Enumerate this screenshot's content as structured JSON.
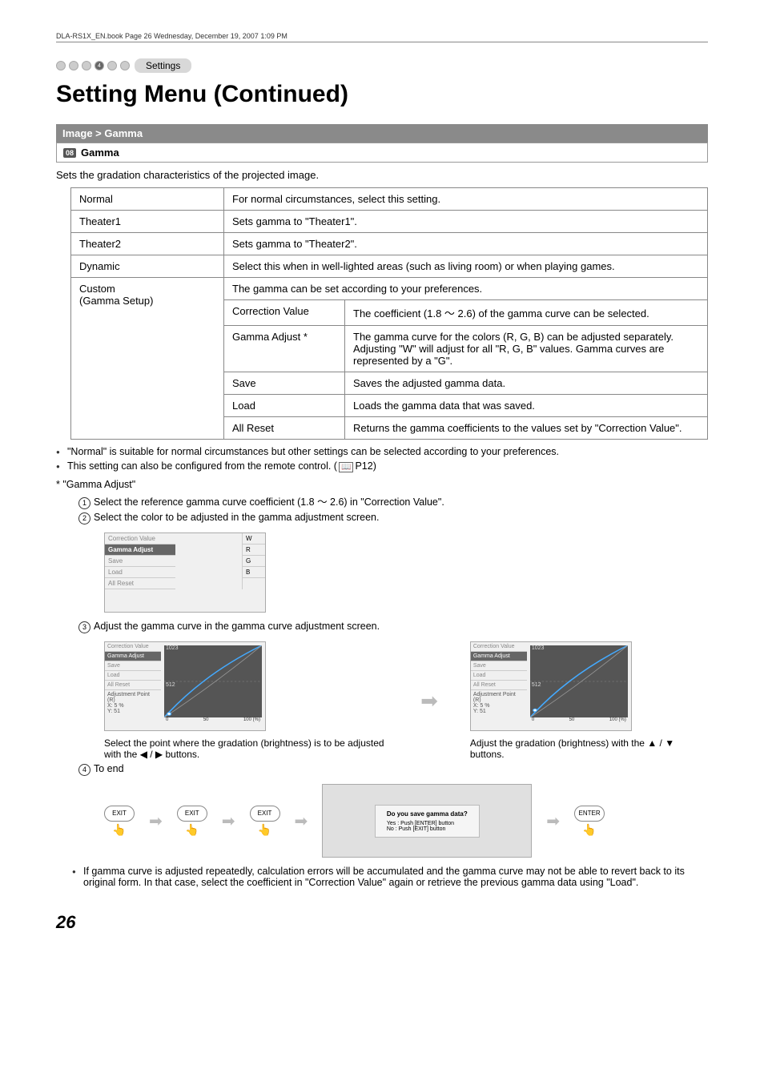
{
  "header": {
    "book_info": "DLA-RS1X_EN.book  Page 26  Wednesday, December 19, 2007  1:09 PM"
  },
  "tab": {
    "number": "4",
    "label": "Settings"
  },
  "title": "Setting Menu (Continued)",
  "breadcrumb": "Image > Gamma",
  "section": {
    "badge": "08",
    "name": "Gamma"
  },
  "intro": "Sets the gradation characteristics of the projected image.",
  "rows": {
    "normal": {
      "name": "Normal",
      "desc": "For normal circumstances, select this setting."
    },
    "theater1": {
      "name": "Theater1",
      "desc": "Sets gamma to \"Theater1\"."
    },
    "theater2": {
      "name": "Theater2",
      "desc": "Sets gamma to \"Theater2\"."
    },
    "dynamic": {
      "name": "Dynamic",
      "desc": "Select this when in well-lighted areas (such as living room) or when playing games."
    },
    "custom": {
      "name": "Custom",
      "sub": "(Gamma Setup)",
      "desc": "The gamma can be set according to your preferences.",
      "items": {
        "correction": {
          "label": "Correction Value",
          "desc": "The coefficient (1.8 ～ 2.6) of the gamma curve can be selected."
        },
        "adjust": {
          "label": "Gamma Adjust *",
          "desc": "The gamma curve for the colors (R, G, B) can be adjusted separately.\nAdjusting \"W\" will adjust for all \"R, G, B\" values. Gamma curves are represented by a \"G\"."
        },
        "save": {
          "label": "Save",
          "desc": "Saves the adjusted gamma data."
        },
        "load": {
          "label": "Load",
          "desc": "Loads the gamma data that was saved."
        },
        "reset": {
          "label": "All Reset",
          "desc": "Returns the gamma coefficients to the values set by \"Correction Value\"."
        }
      }
    }
  },
  "notes": {
    "n1": "\"Normal\" is suitable for normal circumstances but other settings can be selected according to your preferences.",
    "n2_pre": "This setting can also be configured from the remote control. (",
    "n2_ref": "P12",
    "n2_post": ")"
  },
  "gamma_adjust_title": "* \"Gamma Adjust\"",
  "steps": {
    "s1": "Select the reference gamma curve coefficient (1.8 ～ 2.6) in \"Correction Value\".",
    "s2": "Select the color to be adjusted in the gamma adjustment screen.",
    "s3": "Adjust the gamma curve in the gamma curve adjustment screen.",
    "s4": "To end"
  },
  "mini1": {
    "items": [
      "Correction Value",
      "Gamma Adjust",
      "Save",
      "Load",
      "All Reset"
    ],
    "right": [
      "W",
      "R",
      "G",
      "B"
    ]
  },
  "curve": {
    "left_items": [
      "Correction Value",
      "Gamma Adjust",
      "Save",
      "Load",
      "All Reset"
    ],
    "adj_label": "Adjustment Point (R)",
    "adj_x": "X:    5 %",
    "adj_y": "Y:   51",
    "y_top": "1023",
    "y_mid": "512",
    "x0": "0",
    "x1": "50",
    "x2": "100 (%)"
  },
  "caption1_a": "Select the point where the gradation (brightness) is to be adjusted with the ",
  "caption1_b": " buttons.",
  "caption2_a": "Adjust the gradation (brightness) with the ",
  "caption2_b": " buttons.",
  "exit_label": "EXIT",
  "enter_label": "ENTER",
  "dialog": {
    "q": "Do you save gamma data?",
    "yes": "Yes : Push [ENTER] button",
    "no": "No  : Push [EXIT] button"
  },
  "final_note": "If gamma curve is adjusted repeatedly, calculation errors will be accumulated and the gamma curve may not be able to revert back to its original form. In that case, select the coefficient in \"Correction Value\" again or retrieve the previous gamma data using \"Load\".",
  "page_number": "26",
  "chart_data": {
    "type": "line",
    "title": "Gamma curve adjustment",
    "xlabel": "(%)",
    "ylabel": "",
    "xlim": [
      0,
      100
    ],
    "ylim": [
      0,
      1023
    ],
    "x": [
      0,
      10,
      20,
      30,
      40,
      50,
      60,
      70,
      80,
      90,
      100
    ],
    "series": [
      {
        "name": "R",
        "values": [
          0,
          51,
          140,
          240,
          350,
          470,
          590,
          710,
          820,
          930,
          1023
        ]
      }
    ],
    "adjustment_point": {
      "x_percent": 5,
      "y": 51
    }
  }
}
